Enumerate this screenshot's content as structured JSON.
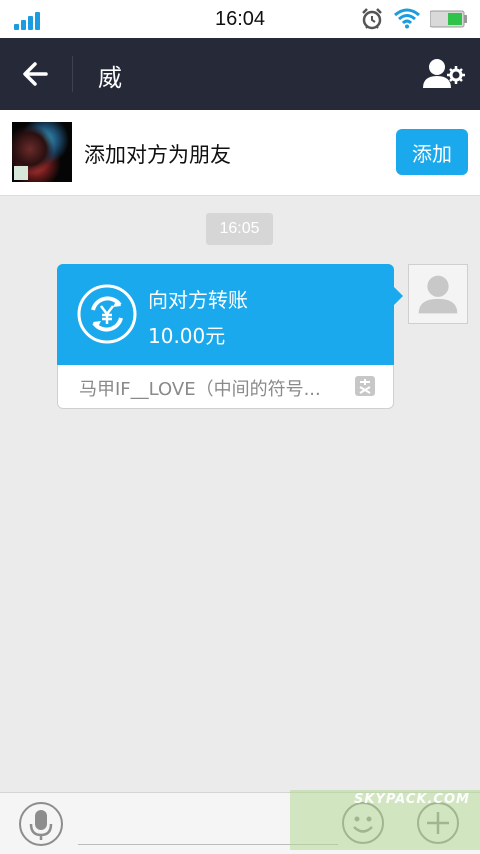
{
  "status_bar": {
    "time": "16:04",
    "icons": [
      "signal-icon",
      "alarm-icon",
      "wifi-icon",
      "battery-icon"
    ]
  },
  "header": {
    "title": "威",
    "icons": [
      "back-arrow-icon",
      "user-settings-icon"
    ]
  },
  "add_friend": {
    "text": "添加对方为朋友",
    "button_label": "添加"
  },
  "chat": {
    "timestamp": "16:05",
    "transfer": {
      "title": "向对方转账",
      "amount": "10.00元",
      "note": "马甲IF__LOVE（中间的符号...",
      "icon": "yuan-transfer-icon"
    }
  },
  "input_bar": {
    "icons": [
      "microphone-icon",
      "emoji-icon",
      "plus-icon"
    ]
  },
  "watermark": {
    "text": "SKYPACK.COM"
  },
  "colors": {
    "header_bg": "#262a38",
    "accent": "#1aa9ec",
    "chat_bg": "#ebebeb"
  }
}
